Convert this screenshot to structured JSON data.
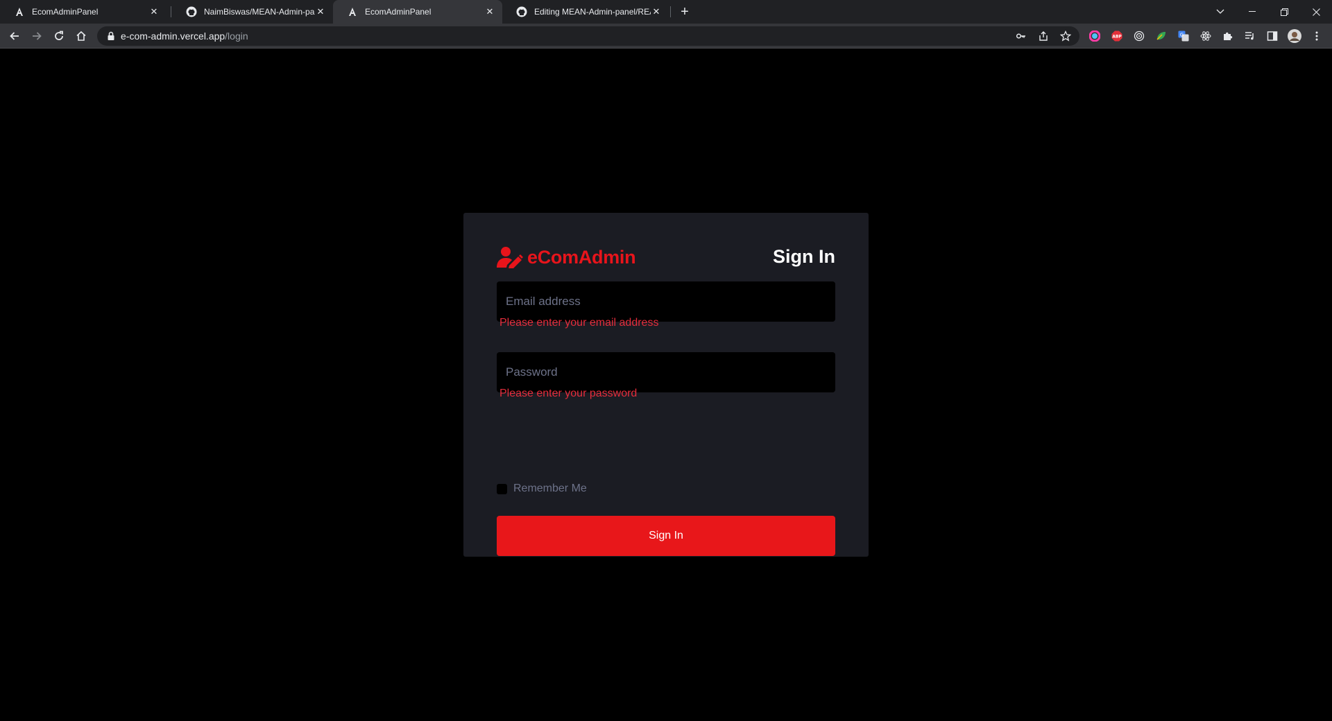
{
  "browser": {
    "tabs": [
      {
        "title": "EcomAdminPanel",
        "favicon": "angular-a-icon",
        "active": false
      },
      {
        "title": "NaimBiswas/MEAN-Admin-panel",
        "favicon": "github-icon",
        "active": false
      },
      {
        "title": "EcomAdminPanel",
        "favicon": "angular-a-icon",
        "active": true
      },
      {
        "title": "Editing MEAN-Admin-panel/README",
        "favicon": "github-icon",
        "active": false
      }
    ],
    "url_host": "e-com-admin.vercel.app",
    "url_path": "/login"
  },
  "login": {
    "brand": "eComAdmin",
    "heading": "Sign In",
    "email_placeholder": "Email address",
    "email_error": "Please enter your email address",
    "password_placeholder": "Password",
    "password_error": "Please enter your password",
    "remember_label": "Remember Me",
    "submit_label": "Sign In"
  },
  "colors": {
    "accent": "#e8171a",
    "error": "#e52d3c",
    "card_bg": "#1b1c23",
    "page_bg": "#000000"
  }
}
